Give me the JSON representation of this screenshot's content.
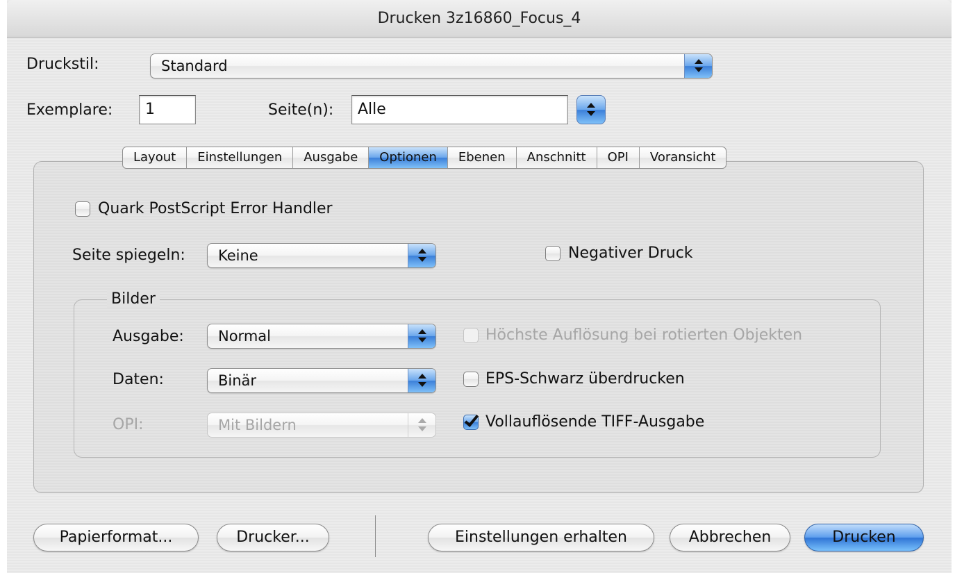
{
  "window": {
    "title": "Drucken 3z16860_Focus_4"
  },
  "top": {
    "druckstil_label": "Druckstil:",
    "druckstil_value": "Standard",
    "exemplare_label": "Exemplare:",
    "exemplare_value": "1",
    "seiten_label": "Seite(n):",
    "seiten_value": "Alle"
  },
  "tabs": [
    {
      "label": "Layout",
      "selected": false
    },
    {
      "label": "Einstellungen",
      "selected": false
    },
    {
      "label": "Ausgabe",
      "selected": false
    },
    {
      "label": "Optionen",
      "selected": true
    },
    {
      "label": "Ebenen",
      "selected": false
    },
    {
      "label": "Anschnitt",
      "selected": false
    },
    {
      "label": "OPI",
      "selected": false
    },
    {
      "label": "Voransicht",
      "selected": false
    }
  ],
  "options": {
    "error_handler": {
      "label": "Quark PostScript Error Handler",
      "checked": false
    },
    "spiegeln_label": "Seite spiegeln:",
    "spiegeln_value": "Keine",
    "negativ": {
      "label": "Negativer Druck",
      "checked": false
    }
  },
  "bilder": {
    "legend": "Bilder",
    "ausgabe_label": "Ausgabe:",
    "ausgabe_value": "Normal",
    "daten_label": "Daten:",
    "daten_value": "Binär",
    "opi_label": "OPI:",
    "opi_value": "Mit Bildern",
    "hoechste": {
      "label": "Höchste Auflösung bei rotierten Objekten",
      "checked": false,
      "enabled": false
    },
    "eps": {
      "label": "EPS-Schwarz überdrucken",
      "checked": false
    },
    "tiff": {
      "label": "Vollauflösende TIFF-Ausgabe",
      "checked": true
    }
  },
  "buttons": {
    "papierformat": "Papierformat...",
    "drucker": "Drucker...",
    "einstellungen_erhalten": "Einstellungen erhalten",
    "abbrechen": "Abbrechen",
    "drucken": "Drucken"
  },
  "colors": {
    "accent": "#3b7fd9",
    "window_bg": "#ececec"
  }
}
